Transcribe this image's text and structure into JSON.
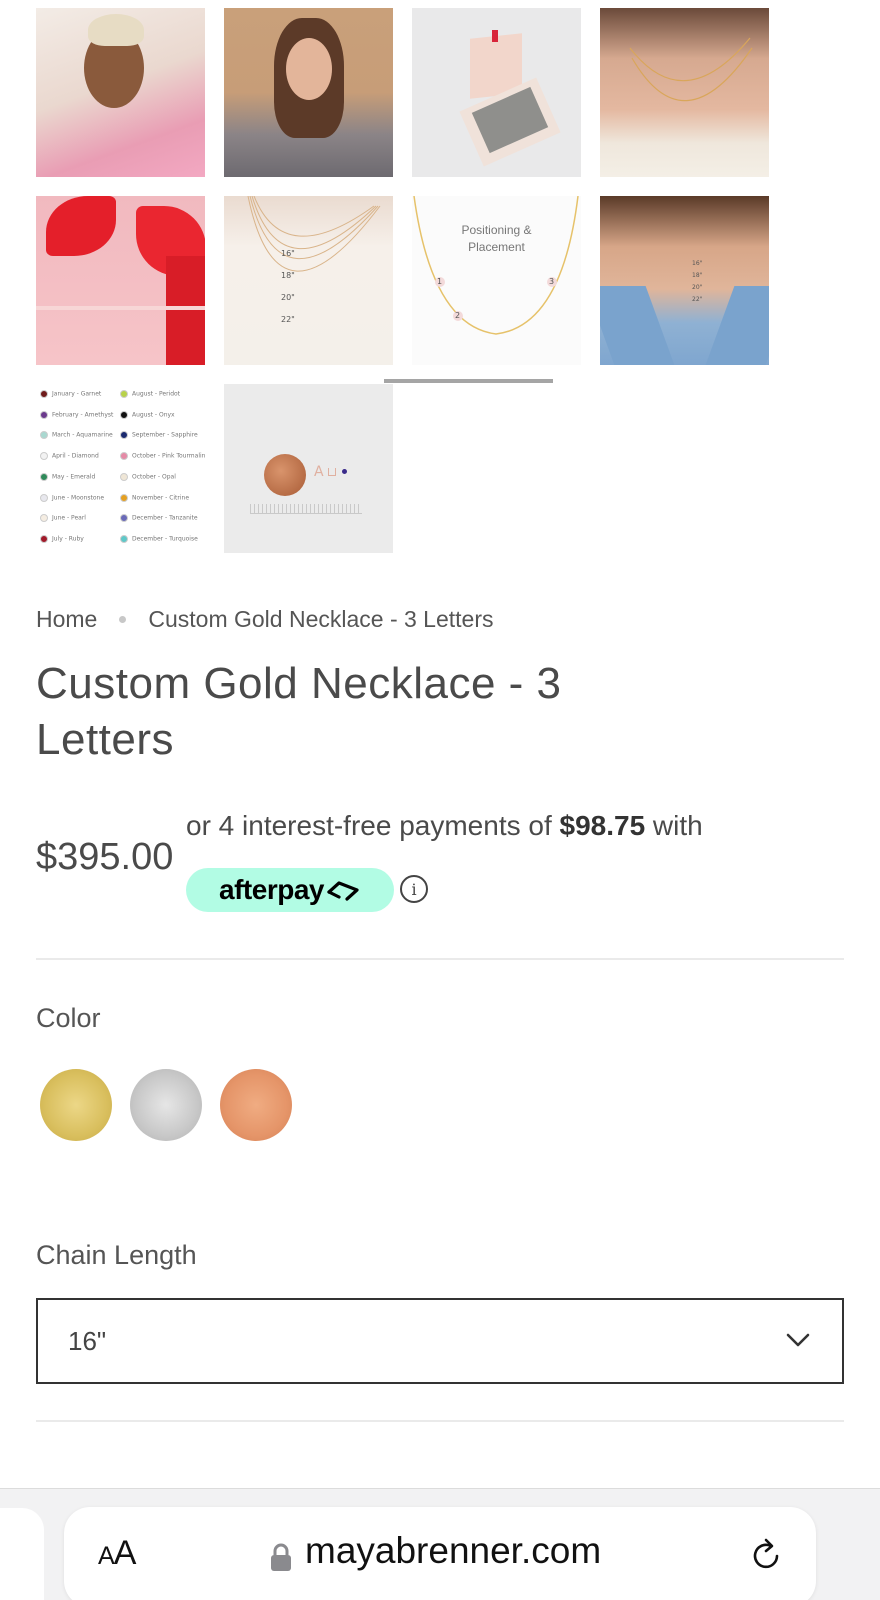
{
  "gallery": {
    "items": [
      {
        "name": "model-pink-pajamas"
      },
      {
        "name": "model-gray-top"
      },
      {
        "name": "gift-box"
      },
      {
        "name": "layered-necklaces-sweater"
      },
      {
        "name": "necklaces-red-ribbon"
      },
      {
        "name": "chain-length-guide",
        "lengths": [
          "16\"",
          "18\"",
          "20\"",
          "22\""
        ]
      },
      {
        "name": "positioning-diagram",
        "caption_line1": "Positioning &",
        "caption_line2": "Placement",
        "markers": [
          "1",
          "2",
          "3"
        ]
      },
      {
        "name": "model-denim-shirt",
        "lengths": [
          "16\"",
          "18\"",
          "20\"",
          "22\""
        ]
      },
      {
        "name": "birthstone-chart"
      },
      {
        "name": "size-reference-penny",
        "letters": "A"
      }
    ],
    "active_index": 6,
    "birthstones_left": [
      {
        "label": "January - Garnet",
        "color": "#6e1a1a"
      },
      {
        "label": "February - Amethyst",
        "color": "#6b3a8c"
      },
      {
        "label": "March - Aquamarine",
        "color": "#a9d8d0"
      },
      {
        "label": "April - Diamond",
        "color": "#f2f2f2"
      },
      {
        "label": "May - Emerald",
        "color": "#2f8a5a"
      },
      {
        "label": "June - Moonstone",
        "color": "#e8e8ee"
      },
      {
        "label": "June - Pearl",
        "color": "#f5ede2"
      },
      {
        "label": "July - Ruby",
        "color": "#a11a2a"
      }
    ],
    "birthstones_right": [
      {
        "label": "August - Peridot",
        "color": "#b8d24a"
      },
      {
        "label": "August - Onyx",
        "color": "#111111"
      },
      {
        "label": "September - Sapphire",
        "color": "#1a2a6e"
      },
      {
        "label": "October - Pink Tourmaline",
        "color": "#e58aa6"
      },
      {
        "label": "October - Opal",
        "color": "#efe6d6"
      },
      {
        "label": "November - Citrine",
        "color": "#e5a021"
      },
      {
        "label": "December - Tanzanite",
        "color": "#6a6ab8"
      },
      {
        "label": "December - Turquoise",
        "color": "#5fc8c8"
      }
    ]
  },
  "breadcrumb": {
    "home": "Home",
    "current": "Custom Gold Necklace - 3 Letters"
  },
  "product": {
    "title": "Custom Gold Necklace - 3 Letters",
    "price": "$395.00",
    "afterpay_prefix": "or 4 interest-free payments of ",
    "afterpay_amount": "$98.75",
    "afterpay_suffix": " with",
    "afterpay_logo": "afterpay",
    "info_icon": "i"
  },
  "color": {
    "label": "Color",
    "options": [
      {
        "name": "gold",
        "color": "#d9c06a"
      },
      {
        "name": "silver",
        "color": "#c9c9c9"
      },
      {
        "name": "rose-gold",
        "color": "#e59a70"
      }
    ]
  },
  "chain_length": {
    "label": "Chain Length",
    "selected": "16\""
  },
  "browser": {
    "text_size_label_small": "A",
    "text_size_label_large": "A",
    "domain": "mayabrenner.com"
  }
}
